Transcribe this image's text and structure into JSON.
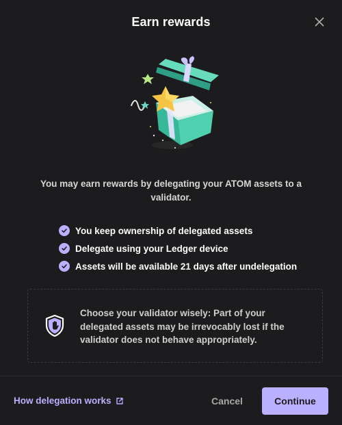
{
  "modal": {
    "title": "Earn rewards",
    "close_icon": "close-icon"
  },
  "illustration": {
    "icon": "gift-box-with-star-illustration"
  },
  "intro_text": "You may earn rewards by delegating your ATOM assets to a validator.",
  "benefits": [
    {
      "label": "You keep ownership of delegated assets",
      "icon": "check-circle-icon"
    },
    {
      "label": "Delegate using your Ledger device",
      "icon": "check-circle-icon"
    },
    {
      "label": "Assets will be available 21 days after undelegation",
      "icon": "check-circle-icon"
    }
  ],
  "warning": {
    "icon": "shield-hand-icon",
    "text": "Choose your validator wisely: Part of your delegated assets may be irrevocably lost if the validator does not behave appropriately."
  },
  "footer": {
    "link_label": "How delegation works",
    "link_icon": "external-link-icon",
    "cancel_label": "Cancel",
    "continue_label": "Continue"
  },
  "colors": {
    "background": "#1c1c1e",
    "accent": "#bbb0ff",
    "text_primary": "#ffffff",
    "text_secondary": "#d6d6d6"
  }
}
